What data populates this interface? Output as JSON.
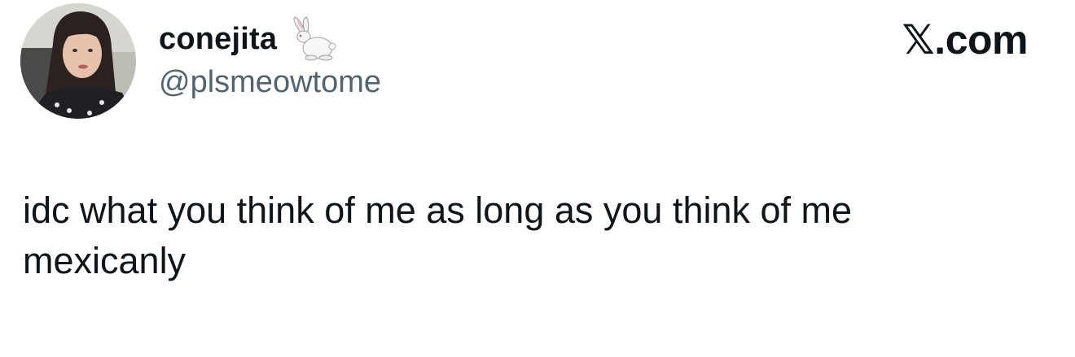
{
  "author": {
    "display_name": "conejita",
    "name_emoji": "rabbit-icon",
    "handle": "@plsmeowtome"
  },
  "brand": {
    "logo_text": "𝕏.com"
  },
  "tweet": {
    "text": "idc what you think of me as long as you think of me\nmexicanly"
  },
  "colors": {
    "text_primary": "#0f1419",
    "text_secondary": "#536471",
    "background": "#ffffff"
  }
}
